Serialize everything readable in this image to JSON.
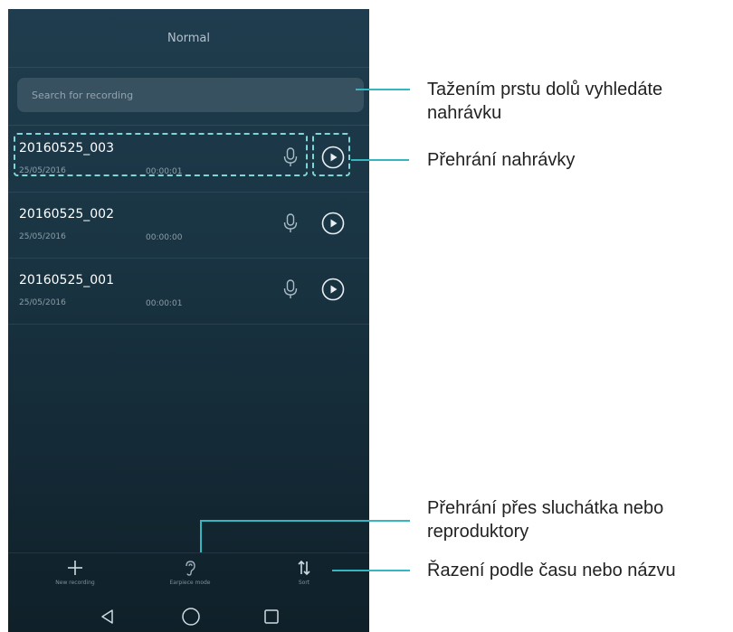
{
  "header": {
    "mode_title": "Normal"
  },
  "search": {
    "placeholder": "Search for recording"
  },
  "recordings": [
    {
      "name": "20160525_003",
      "date": "25/05/2016",
      "duration": "00:00:01"
    },
    {
      "name": "20160525_002",
      "date": "25/05/2016",
      "duration": "00:00:00"
    },
    {
      "name": "20160525_001",
      "date": "25/05/2016",
      "duration": "00:00:01"
    }
  ],
  "bottom_bar": {
    "new_recording": "New recording",
    "earpiece_mode": "Earpiece mode",
    "sort": "Sort"
  },
  "callouts": {
    "search_line1": "Tažením prstu dolů vyhledáte",
    "search_line2": "nahrávku",
    "play": "Přehrání nahrávky",
    "earpiece_line1": "Přehrání přes sluchátka nebo",
    "earpiece_line2": "reproduktory",
    "sort": "Řazení podle času nebo názvu"
  },
  "colors": {
    "accent": "#36b7bf",
    "background_top": "#1f3d4e",
    "background_bottom": "#0f2029"
  }
}
